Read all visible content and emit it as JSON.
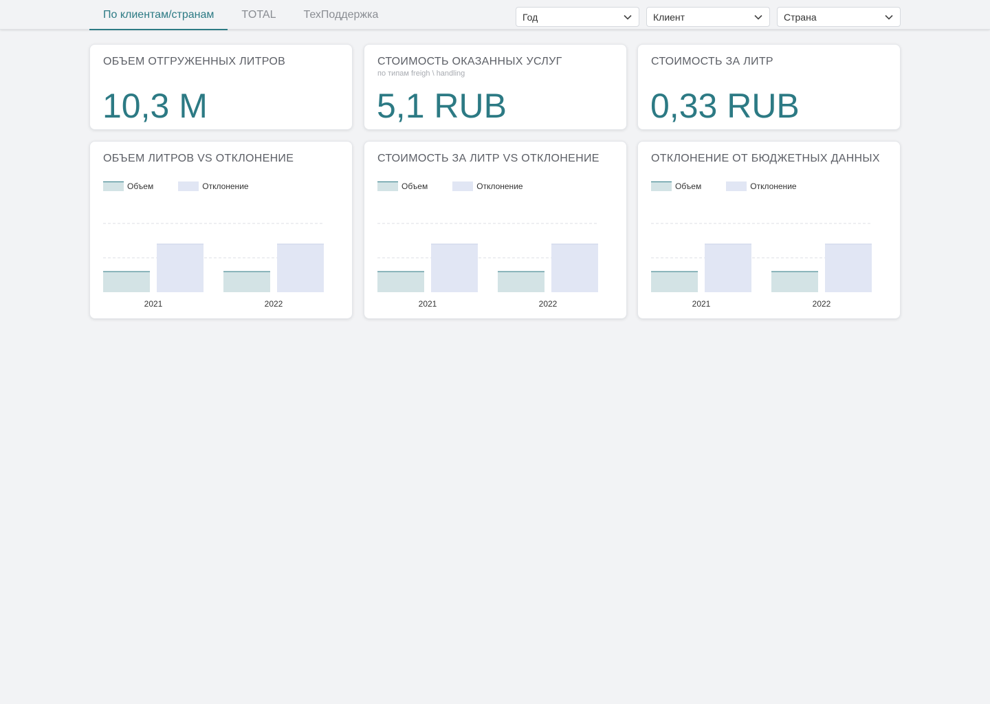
{
  "tabs": [
    {
      "label": "По клиентам/странам",
      "active": true
    },
    {
      "label": "TOTAL",
      "active": false
    },
    {
      "label": "ТехПоддержка",
      "active": false
    }
  ],
  "filters": [
    {
      "label": "Год",
      "icon": "chevron-down-icon"
    },
    {
      "label": "Клиент",
      "icon": "chevron-down-icon"
    },
    {
      "label": "Страна",
      "icon": "chevron-down-icon"
    }
  ],
  "kpis": [
    {
      "title": "ОБЪЕМ ОТГРУЖЕННЫХ ЛИТРОВ",
      "subtitle": "",
      "value": "10,3 M"
    },
    {
      "title": "СТОИМОСТЬ ОКАЗАННЫХ УСЛУГ",
      "subtitle": "по типам freigh \\ handling",
      "value": "5,1 RUB"
    },
    {
      "title": "СТОИМОСТЬ ЗА ЛИТР",
      "subtitle": "",
      "value": "0,33 RUB"
    }
  ],
  "colors": {
    "accent": "#2c7a84",
    "volume_fill": "#d3e3e5",
    "deviation_fill": "#e1e6f4",
    "background": "#f2f3f5"
  },
  "chart_data": [
    {
      "type": "bar",
      "title": "ОБЪЕМ ЛИТРОВ VS ОТКЛОНЕНИЕ",
      "categories": [
        "2021",
        "2022"
      ],
      "series": [
        {
          "name": "Объем",
          "values": [
            30,
            30
          ]
        },
        {
          "name": "Отклонение",
          "values": [
            70,
            70
          ]
        }
      ],
      "ylim": [
        0,
        100
      ],
      "grid": true,
      "legend": "top-left"
    },
    {
      "type": "bar",
      "title": "СТОИМОСТЬ ЗА ЛИТР VS ОТКЛОНЕНИЕ",
      "categories": [
        "2021",
        "2022"
      ],
      "series": [
        {
          "name": "Объем",
          "values": [
            30,
            30
          ]
        },
        {
          "name": "Отклонение",
          "values": [
            70,
            70
          ]
        }
      ],
      "ylim": [
        0,
        100
      ],
      "grid": true,
      "legend": "top-left"
    },
    {
      "type": "bar",
      "title": "ОТКЛОНЕНИЕ ОТ БЮДЖЕТНЫХ ДАННЫХ",
      "categories": [
        "2021",
        "2022"
      ],
      "series": [
        {
          "name": "Объем",
          "values": [
            30,
            30
          ]
        },
        {
          "name": "Отклонение",
          "values": [
            70,
            70
          ]
        }
      ],
      "ylim": [
        0,
        100
      ],
      "grid": true,
      "legend": "top-left"
    }
  ]
}
